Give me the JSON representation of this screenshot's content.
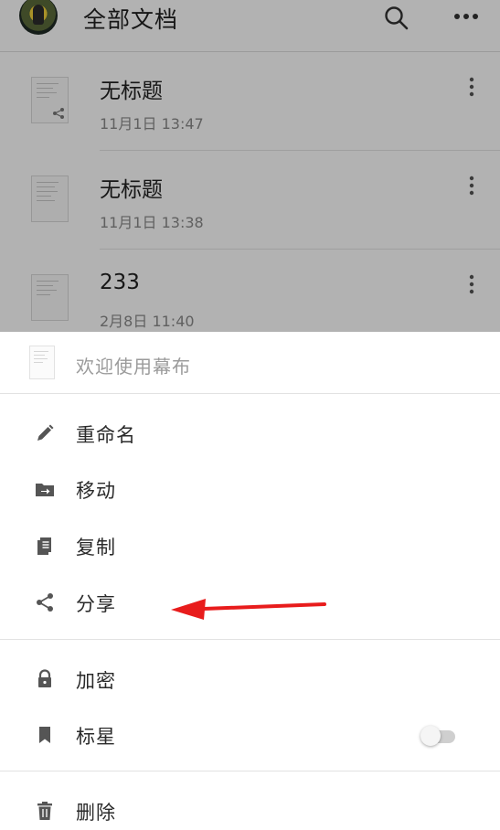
{
  "header": {
    "title": "全部文档",
    "icons": [
      "avatar",
      "search-icon",
      "more-icon"
    ]
  },
  "documents": [
    {
      "title": "无标题",
      "time": "11月1日 13:47",
      "shared": true
    },
    {
      "title": "无标题",
      "time": "11月1日 13:38",
      "shared": false
    },
    {
      "title": "233",
      "time": "2月8日 11:40",
      "shared": false
    }
  ],
  "sheet": {
    "doc_name": "欢迎使用幕布",
    "actions": {
      "rename": "重命名",
      "move": "移动",
      "copy": "复制",
      "share": "分享",
      "encrypt": "加密",
      "star": "标星",
      "delete": "删除"
    },
    "star_enabled": false
  },
  "colors": {
    "annotation_arrow": "#e81c1c",
    "icon": "#555555",
    "overlay": "rgba(0,0,0,0.30)"
  }
}
